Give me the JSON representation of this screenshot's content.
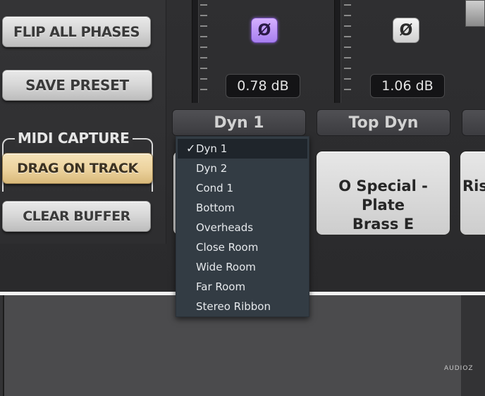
{
  "left_panel": {
    "flip_all_phases": "FLIP ALL PHASES",
    "save_preset": "SAVE PRESET",
    "midi_capture_label": "MIDI CAPTURE",
    "drag_on_track": "DRAG ON TRACK",
    "clear_buffer": "CLEAR BUFFER"
  },
  "channels": [
    {
      "phase_symbol": "Ø",
      "phase_active": true,
      "level": "0.78 dB",
      "mic": "Dyn 1",
      "preset": ""
    },
    {
      "phase_symbol": "Ø",
      "phase_active": false,
      "level": "1.06 dB",
      "mic": "Top Dyn",
      "preset_line1": "O Special - Plate",
      "preset_line2": "Brass E"
    },
    {
      "preset": "Risi"
    }
  ],
  "menu": {
    "items": [
      "Dyn 1",
      "Dyn 2",
      "Cond 1",
      "Bottom",
      "Overheads",
      "Close Room",
      "Wide Room",
      "Far Room",
      "Stereo Ribbon"
    ],
    "selected": "Dyn 1",
    "check_mark": "✓"
  },
  "colors": {
    "phase_active": "#b48cf8",
    "drag_button": "#ecd29d",
    "menu_bg": "#333c44"
  },
  "watermark": "AUDIOZ"
}
